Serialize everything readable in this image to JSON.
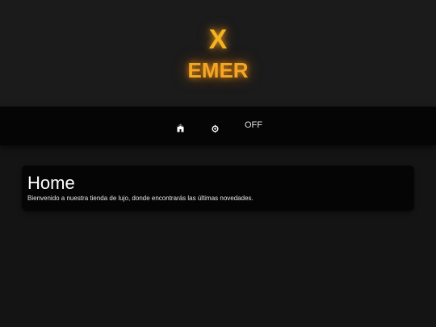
{
  "header": {
    "logo_mark": "X",
    "logo_text": "EMER"
  },
  "nav": {
    "home_icon": "home-icon",
    "settings_icon": "gear-icon",
    "theme_toggle_label": "OFF"
  },
  "main": {
    "title": "Home",
    "description": "Bienvenido a nuestra tienda de lujo, donde encontrarás las últimas novedades."
  },
  "colors": {
    "accent": "#f5a623",
    "header_bg": "#1b1b1b",
    "nav_bg": "#050505",
    "page_bg": "#141414"
  }
}
